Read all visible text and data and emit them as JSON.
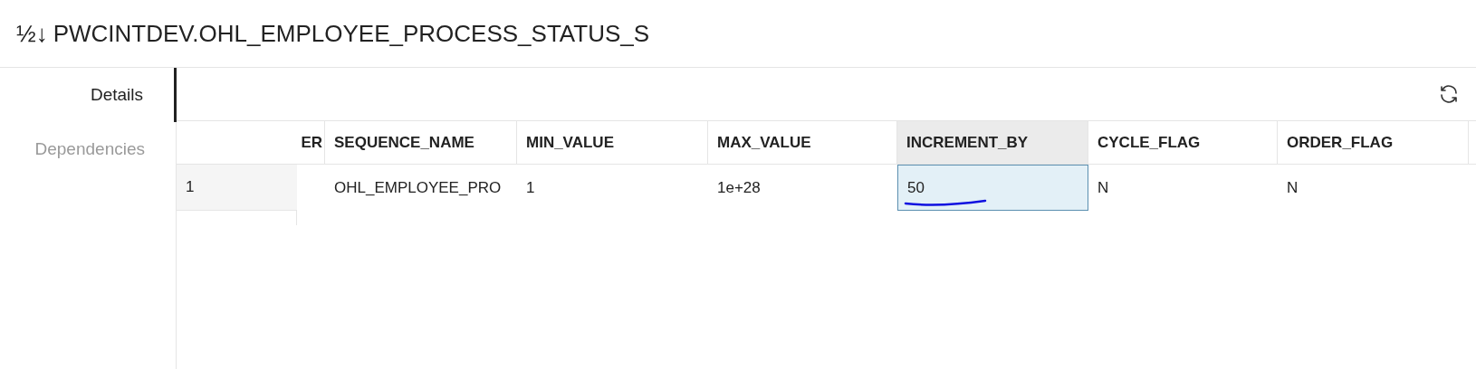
{
  "title_icon": "½↓",
  "title": "PWCINTDEV.OHL_EMPLOYEE_PROCESS_STATUS_S",
  "tabs": [
    {
      "label": "Details",
      "selected": true
    },
    {
      "label": "Dependencies",
      "selected": false
    }
  ],
  "table": {
    "columns": [
      {
        "label": "ER",
        "selected": false
      },
      {
        "label": "SEQUENCE_NAME",
        "selected": false
      },
      {
        "label": "MIN_VALUE",
        "selected": false
      },
      {
        "label": "MAX_VALUE",
        "selected": false
      },
      {
        "label": "INCREMENT_BY",
        "selected": true
      },
      {
        "label": "CYCLE_FLAG",
        "selected": false
      },
      {
        "label": "ORDER_FLAG",
        "selected": false
      }
    ],
    "rows": [
      {
        "number": "1",
        "cells": [
          {
            "text": ""
          },
          {
            "text": "OHL_EMPLOYEE_PRO"
          },
          {
            "text": "1"
          },
          {
            "text": "1e+28"
          },
          {
            "text": "50",
            "selected": true,
            "underlined": true
          },
          {
            "text": "N"
          },
          {
            "text": "N"
          }
        ]
      }
    ]
  }
}
